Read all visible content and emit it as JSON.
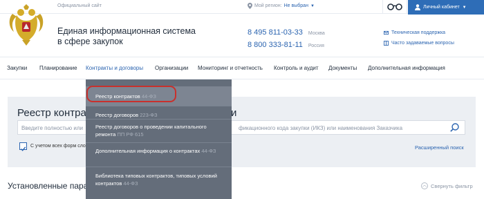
{
  "top": {
    "official_site": "Официальный сайт",
    "region_label": "Мой регион:",
    "region_value": "Не выбран",
    "cabinet": "Личный кабинет"
  },
  "header": {
    "system_title_line1": "Единая информационная система",
    "system_title_line2": "в сфере закупок",
    "phones": [
      {
        "number": "8 495 811-03-33",
        "city": "Москва"
      },
      {
        "number": "8 800 333-81-11",
        "city": "Россия"
      }
    ],
    "support_links": [
      "Техническая поддержка",
      "Часто задаваемые вопросы"
    ]
  },
  "nav": {
    "items": [
      "Закупки",
      "Планирование",
      "Контракты и договоры",
      "Организации",
      "Мониторинг и отчетность",
      "Контроль и аудит",
      "Документы",
      "Дополнительная информация"
    ],
    "active_index": 2
  },
  "dropdown": {
    "items": [
      {
        "label": "Реестр контрактов",
        "law": "44-ФЗ"
      },
      {
        "label": "Реестр договоров",
        "law": "223-ФЗ"
      },
      {
        "label": "Реестр договоров о проведении капитального ремонта",
        "law": "ПП РФ 615"
      },
      {
        "label": "Дополнительная информация о контрактах",
        "law": "44-ФЗ"
      },
      {
        "label": "Библиотека типовых контрактов, типовых условий контрактов",
        "law": "44-ФЗ"
      }
    ]
  },
  "panel": {
    "title_left": "Реестр контра",
    "title_right": "и",
    "placeholder_left": "Введите полностью или",
    "placeholder_right": "фикационного кода закупки (ИКЗ) или наименования Заказчика",
    "checkbox_label": "С учетом всех форм сло",
    "checkbox_checked": true,
    "advanced_search": "Расширенный поиск"
  },
  "params_title": "Установленные парам",
  "collapse_filter": "Свернуть фильтр",
  "colors": {
    "accent": "#2e6db7",
    "link": "#2b64b0",
    "dropdown_bg": "#646d7a",
    "highlight": "#c9302c"
  }
}
